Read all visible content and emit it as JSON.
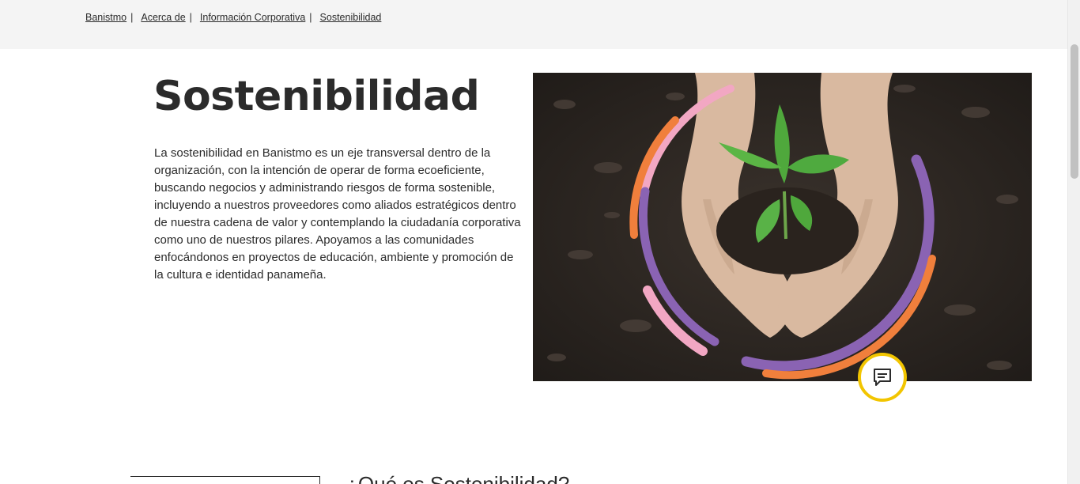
{
  "breadcrumb": {
    "items": [
      "Banistmo",
      "Acerca de",
      "Información Corporativa",
      "Sostenibilidad"
    ],
    "separator": "|"
  },
  "hero": {
    "title": "Sostenibilidad",
    "body": "La sostenibilidad en Banistmo es un eje transversal dentro de la organización, con la intención de operar de forma ecoeficiente, buscando negocios y administrando riesgos de forma sostenible, incluyendo a nuestros proveedores como aliados estratégicos dentro de nuestra cadena de valor y contemplando la ciudadanía corporativa como uno de nuestros pilares.  Apoyamos a las comunidades enfocándonos en proyectos de educación, ambiente y promoción de la cultura e identidad panameña.",
    "image_icon": "hands-holding-seedling-photo"
  },
  "section": {
    "title": "¿Qué es Sostenibilidad?"
  },
  "chat": {
    "icon": "chat-bubble-icon"
  },
  "colors": {
    "accent_yellow": "#f2c500",
    "ring_purple": "#8a63b3",
    "ring_orange": "#f07f3c",
    "ring_pink": "#f2a7c3"
  }
}
